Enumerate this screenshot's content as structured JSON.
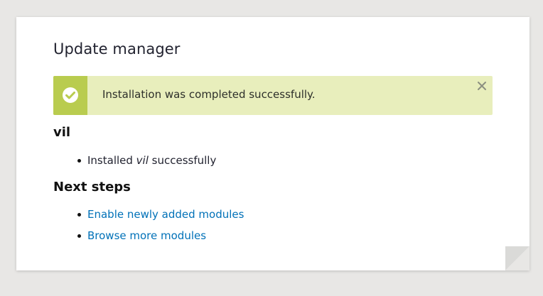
{
  "page": {
    "title": "Update manager"
  },
  "message": {
    "type": "status",
    "text": "Installation was completed successfully.",
    "icon": "check-circle-icon",
    "close_icon": "close-icon",
    "colors": {
      "background": "#e8eebc",
      "accent": "#b9cc4f"
    }
  },
  "module": {
    "name": "vil",
    "result_prefix": "Installed ",
    "result_name": "vil",
    "result_suffix": " successfully"
  },
  "next_steps": {
    "title": "Next steps",
    "links": [
      {
        "label": "Enable newly added modules"
      },
      {
        "label": "Browse more modules"
      }
    ],
    "link_color": "#0071b8"
  }
}
